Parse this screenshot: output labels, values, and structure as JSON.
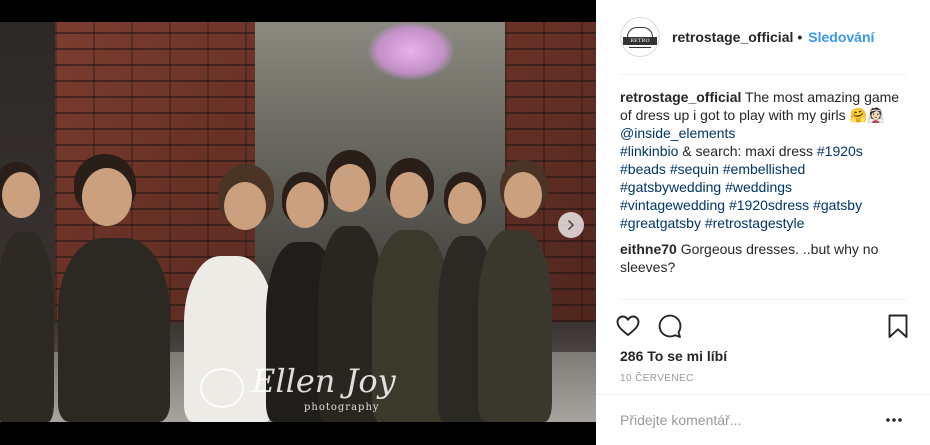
{
  "post": {
    "username": "retrostage_official",
    "separator": "•",
    "follow_label": "Sledování",
    "avatar_text": "RETRO STAGE"
  },
  "caption": {
    "username": "retrostage_official",
    "text": "The most amazing game of dress up i got to play with my girls",
    "emoji": "🤗👰🏻",
    "mention": "@inside_elements",
    "linkinbio": "#linkinbio",
    "search_text": "& search: maxi dress",
    "tags_line": [
      "#1920s",
      "#beads",
      "#sequin",
      "#embellished",
      "#gatsbywedding",
      "#weddings",
      "#vintagewedding",
      "#1920sdress",
      "#gatsby",
      "#greatgatsby",
      "#retrostagestyle"
    ]
  },
  "comment": {
    "username": "eithne70",
    "text": "Gorgeous dresses. ..but why no sleeves?"
  },
  "photo": {
    "watermark": "Ellen Joy",
    "watermark_sub": "photography"
  },
  "stats": {
    "likes": "286 To se mi líbí",
    "date": "10 ČERVENEC"
  },
  "comment_box": {
    "placeholder": "Přidejte komentář..."
  },
  "icons": {
    "like": "heart-icon",
    "comment": "comment-icon",
    "save": "bookmark-icon",
    "more": "more-options-icon",
    "next": "chevron-right-icon"
  },
  "colors": {
    "link": "#3897f0",
    "hashtag": "#003569",
    "muted": "#999999"
  }
}
